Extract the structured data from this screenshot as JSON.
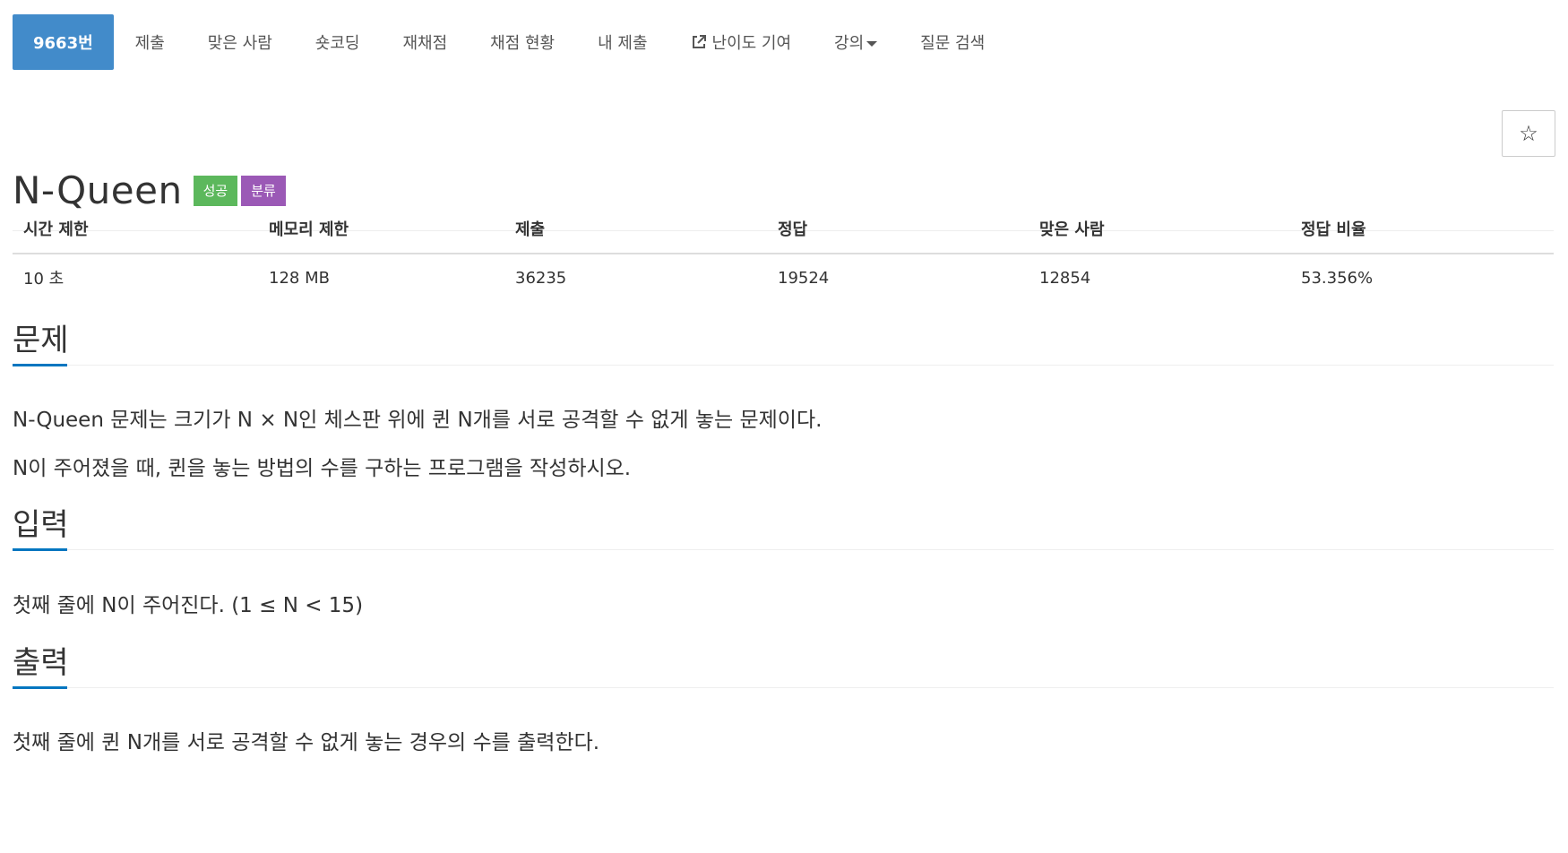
{
  "tabs": [
    {
      "label": "9663번",
      "active": true
    },
    {
      "label": "제출"
    },
    {
      "label": "맞은 사람"
    },
    {
      "label": "숏코딩"
    },
    {
      "label": "재채점"
    },
    {
      "label": "채점 현황"
    },
    {
      "label": "내 제출"
    },
    {
      "label": "난이도 기여",
      "icon": "external-link-icon"
    },
    {
      "label": "강의",
      "icon": "caret-down-icon"
    },
    {
      "label": "질문 검색"
    }
  ],
  "problem": {
    "title": "N-Queen",
    "badges": [
      "성공",
      "분류"
    ],
    "star": "☆"
  },
  "info": {
    "headers": [
      "시간 제한",
      "메모리 제한",
      "제출",
      "정답",
      "맞은 사람",
      "정답 비율"
    ],
    "values": [
      "10 초",
      "128 MB",
      "36235",
      "19524",
      "12854",
      "53.356%"
    ]
  },
  "sections": {
    "problem_title": "문제",
    "problem_p1": "N-Queen 문제는 크기가 N × N인 체스판 위에 퀸 N개를 서로 공격할 수 없게 놓는 문제이다.",
    "problem_p2": "N이 주어졌을 때, 퀸을 놓는 방법의 수를 구하는 프로그램을 작성하시오.",
    "input_title": "입력",
    "input_p1": "첫째 줄에 N이 주어진다. (1 ≤ N < 15)",
    "output_title": "출력",
    "output_p1": "첫째 줄에 퀸 N개를 서로 공격할 수 없게 놓는 경우의 수를 출력한다."
  },
  "colors": {
    "active_tab": "#428bca",
    "success_badge": "#5cb85c",
    "category_badge": "#9b59b6",
    "section_underline": "#0076c0"
  }
}
